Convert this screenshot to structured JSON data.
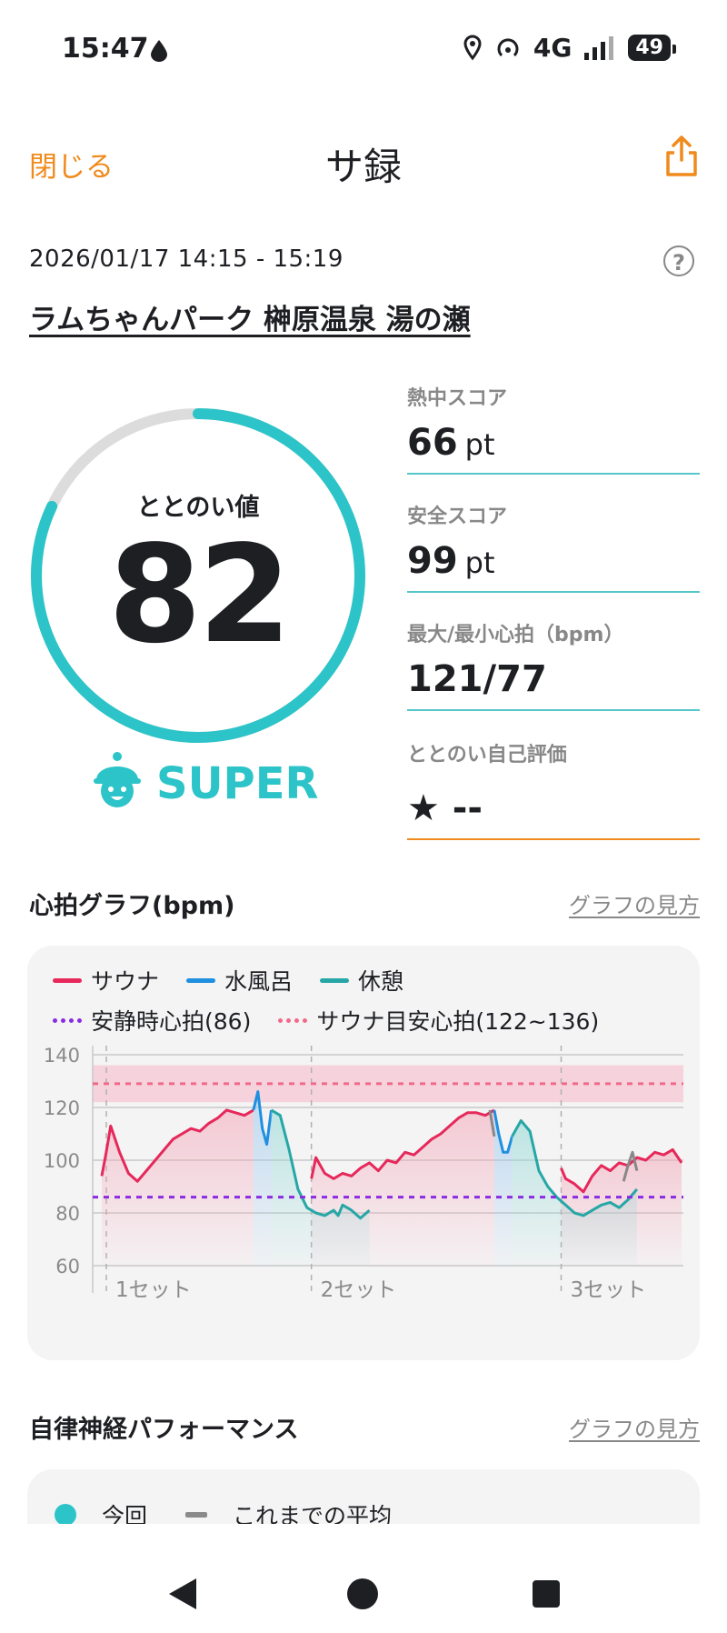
{
  "status": {
    "time": "15:47",
    "network": "4G",
    "battery": "49"
  },
  "header": {
    "close_label": "閉じる",
    "title": "サ録"
  },
  "session": {
    "datetime": "2026/01/17 14:15 - 15:19",
    "facility": "ラムちゃんパーク 榊原温泉 湯の瀬",
    "help_label": "?"
  },
  "score": {
    "label": "ととのい値",
    "value": "82",
    "value_fraction": 0.82,
    "rank": "SUPER"
  },
  "stats": {
    "heat_label": "熱中スコア",
    "heat_value": "66",
    "heat_unit": "pt",
    "safety_label": "安全スコア",
    "safety_value": "99",
    "safety_unit": "pt",
    "hr_label": "最大/最小心拍（bpm）",
    "hr_value": "121/77",
    "self_label": "ととのい自己評価",
    "self_value": "★ --"
  },
  "heart_section": {
    "title": "心拍グラフ(bpm)",
    "guide_link": "グラフの見方"
  },
  "legend": {
    "sauna": "サウナ",
    "cold": "水風呂",
    "rest": "休憩",
    "resting_hr": "安静時心拍(86)",
    "target_hr": "サウナ目安心拍(122~136)"
  },
  "colors": {
    "sauna": "#e6285a",
    "cold": "#1f8fe0",
    "rest": "#26a7a5",
    "resting": "#8a2be2",
    "target": "#f06a8a",
    "accent": "#2cc4c8",
    "orange": "#f08a1c"
  },
  "chart_data": {
    "type": "line",
    "x_unit": "minutes",
    "ylim": [
      60,
      140
    ],
    "y_ticks": [
      "140",
      "120",
      "100",
      "80",
      "60"
    ],
    "set_labels": [
      "1セット",
      "2セット",
      "3セット"
    ],
    "resting_hr": 86,
    "target_band": [
      122,
      136
    ],
    "target_line": 129,
    "series": [
      {
        "name": "サウナ",
        "segments": [
          [
            [
              0,
              94
            ],
            [
              0.5,
              103
            ],
            [
              1,
              113
            ],
            [
              2,
              103
            ],
            [
              3,
              95
            ],
            [
              4,
              92
            ],
            [
              5,
              96
            ],
            [
              6,
              100
            ],
            [
              7,
              104
            ],
            [
              8,
              108
            ],
            [
              9,
              110
            ],
            [
              10,
              112
            ],
            [
              11,
              111
            ],
            [
              12,
              114
            ],
            [
              13,
              116
            ],
            [
              14,
              119
            ],
            [
              15,
              118
            ],
            [
              16,
              117
            ],
            [
              17,
              119
            ]
          ],
          [
            [
              23.5,
              93
            ],
            [
              24,
              101
            ],
            [
              25,
              95
            ],
            [
              26,
              93
            ],
            [
              27,
              95
            ],
            [
              28,
              94
            ],
            [
              29,
              97
            ],
            [
              30,
              99
            ],
            [
              31,
              96
            ],
            [
              32,
              100
            ],
            [
              33,
              99
            ],
            [
              34,
              103
            ],
            [
              35,
              102
            ],
            [
              36,
              105
            ],
            [
              37,
              108
            ],
            [
              38,
              110
            ],
            [
              39,
              113
            ],
            [
              40,
              116
            ],
            [
              41,
              118
            ],
            [
              42,
              118
            ],
            [
              43,
              117
            ],
            [
              44,
              119
            ]
          ],
          [
            [
              51.5,
              97
            ],
            [
              52,
              93
            ],
            [
              53,
              91
            ],
            [
              54,
              88
            ],
            [
              55,
              94
            ],
            [
              56,
              98
            ],
            [
              57,
              96
            ],
            [
              58,
              99
            ],
            [
              59,
              98
            ],
            [
              60,
              101
            ],
            [
              61,
              100
            ],
            [
              62,
              103
            ],
            [
              63,
              102
            ],
            [
              64,
              104
            ],
            [
              65,
              99
            ]
          ]
        ]
      },
      {
        "name": "水風呂",
        "segments": [
          [
            [
              17,
              119
            ],
            [
              17.5,
              126
            ],
            [
              18,
              112
            ],
            [
              18.5,
              106
            ],
            [
              19,
              119
            ]
          ],
          [
            [
              44,
              119
            ],
            [
              44.5,
              110
            ],
            [
              45,
              103
            ],
            [
              45.5,
              103
            ],
            [
              46,
              109
            ]
          ]
        ]
      },
      {
        "name": "休憩",
        "segments": [
          [
            [
              19,
              119
            ],
            [
              20,
              117
            ],
            [
              21,
              104
            ],
            [
              22,
              89
            ],
            [
              23,
              82
            ],
            [
              24,
              80
            ],
            [
              25,
              79
            ],
            [
              26,
              81
            ],
            [
              26.5,
              79
            ],
            [
              27,
              83
            ],
            [
              28,
              81
            ],
            [
              29,
              78
            ],
            [
              30,
              81
            ]
          ],
          [
            [
              46,
              109
            ],
            [
              47,
              115
            ],
            [
              48,
              111
            ],
            [
              49,
              96
            ],
            [
              50,
              90
            ],
            [
              51,
              86
            ],
            [
              52,
              83
            ],
            [
              53,
              80
            ],
            [
              54,
              79
            ],
            [
              55,
              81
            ],
            [
              56,
              83
            ],
            [
              57,
              84
            ],
            [
              58,
              82
            ],
            [
              59,
              85
            ],
            [
              60,
              89
            ]
          ]
        ]
      },
      {
        "name": "other",
        "segments": [
          [
            [
              43.5,
              119
            ],
            [
              44,
              109
            ]
          ],
          [
            [
              58.5,
              92
            ],
            [
              59,
              98
            ],
            [
              59.5,
              103
            ],
            [
              60,
              96
            ]
          ]
        ]
      }
    ]
  },
  "perf_section": {
    "title": "自律神経パフォーマンス",
    "guide_link": "グラフの見方",
    "legend_current": "今回",
    "legend_avg": "これまでの平均"
  }
}
